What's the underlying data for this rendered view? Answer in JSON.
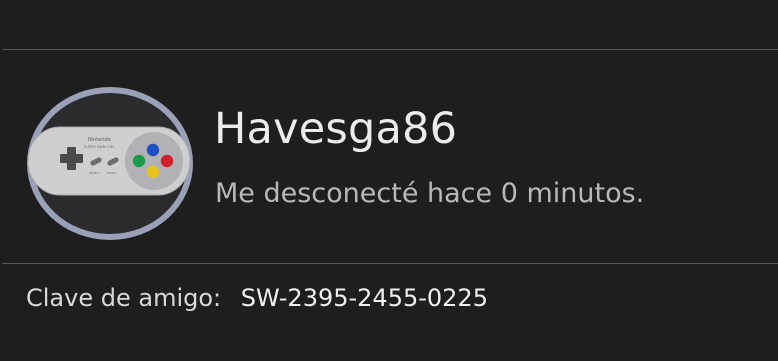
{
  "profile": {
    "username": "Havesga86",
    "status": "Me desconecté hace 0 minutos.",
    "avatar_icon": "snes-controller-icon",
    "avatar_brand": "Nintendo",
    "avatar_model": "SUPER FAMICOM",
    "avatar_select_label": "SELECT",
    "avatar_start_label": "START"
  },
  "friend_code": {
    "label": "Clave de amigo:",
    "value": "SW-2395-2455-0225"
  },
  "colors": {
    "background": "#1e1e1f",
    "divider": "#595959",
    "text_primary": "#ececec",
    "text_secondary": "#b9b9b9",
    "avatar_ring": "#9aa0b5",
    "button_green": "#1a9b4a",
    "button_blue": "#1f4fc4",
    "button_red": "#d4202a",
    "button_yellow": "#e7c21c"
  }
}
